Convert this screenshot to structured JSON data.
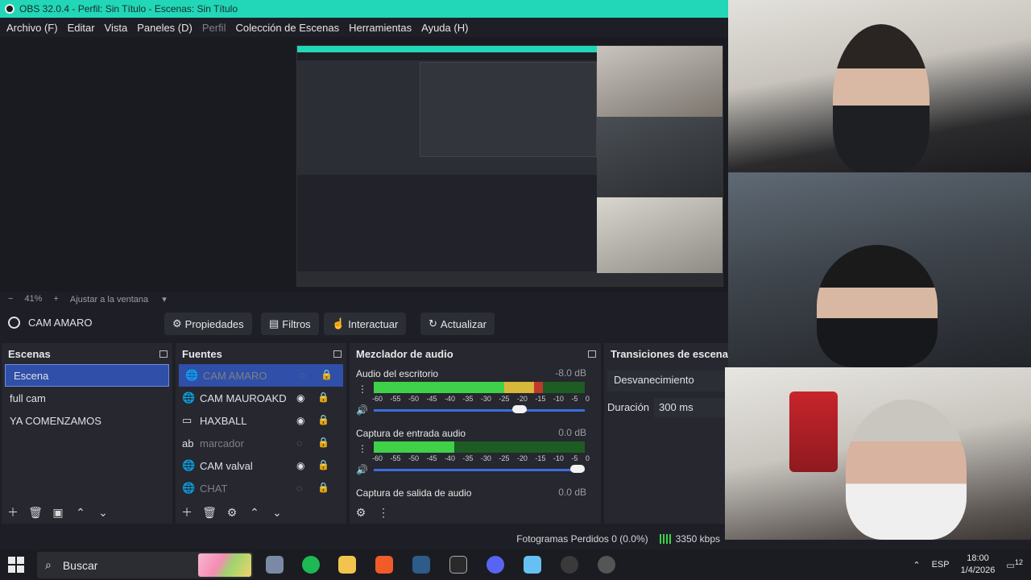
{
  "window": {
    "title": "OBS 32.0.4 - Perfil: Sin Título - Escenas: Sin Título"
  },
  "menu": [
    {
      "label": "Archivo (F)",
      "enabled": true
    },
    {
      "label": "Editar",
      "enabled": true
    },
    {
      "label": "Vista",
      "enabled": true
    },
    {
      "label": "Paneles (D)",
      "enabled": true
    },
    {
      "label": "Perfil",
      "enabled": false
    },
    {
      "label": "Colección de Escenas",
      "enabled": true
    },
    {
      "label": "Herramientas",
      "enabled": true
    },
    {
      "label": "Ayuda (H)",
      "enabled": true
    }
  ],
  "zoom": {
    "minus": "−",
    "value": "41%",
    "plus": "+",
    "fit_label": "Ajustar a la ventana"
  },
  "source_toolbar": {
    "selected_source": "CAM AMARO",
    "properties": "Propiedades",
    "filters": "Filtros",
    "interact": "Interactuar",
    "refresh": "Actualizar"
  },
  "scenes": {
    "title": "Escenas",
    "items": [
      "Escena",
      "full cam",
      "YA COMENZAMOS"
    ],
    "selected_index": 0
  },
  "sources": {
    "title": "Fuentes",
    "items": [
      {
        "name": "CAM AMARO",
        "type": "browser-icon",
        "visible": false,
        "selected": true
      },
      {
        "name": "CAM MAUROAKD",
        "type": "browser-icon",
        "visible": true,
        "selected": false
      },
      {
        "name": "HAXBALL",
        "type": "window-capture-icon",
        "visible": true,
        "selected": false
      },
      {
        "name": "marcador",
        "type": "text-icon",
        "visible": false,
        "selected": false
      },
      {
        "name": "CAM valval",
        "type": "browser-icon",
        "visible": true,
        "selected": false
      },
      {
        "name": "CHAT",
        "type": "browser-icon",
        "visible": false,
        "selected": false
      }
    ]
  },
  "mixer": {
    "title": "Mezclador de audio",
    "channels": [
      {
        "name": "Audio del escritorio",
        "db": "-8.0 dB",
        "level": 0.86,
        "volume": 0.68
      },
      {
        "name": "Captura de entrada audio",
        "db": "0.0 dB",
        "level": 0.36,
        "volume": 1.0
      },
      {
        "name": "Captura de salida de audio",
        "db": "0.0 dB"
      }
    ],
    "ticks": [
      "-60",
      "-55",
      "-50",
      "-45",
      "-40",
      "-35",
      "-30",
      "-25",
      "-20",
      "-15",
      "-10",
      "-5",
      "0"
    ]
  },
  "transitions": {
    "title": "Transiciones de escena",
    "current": "Desvanecimiento",
    "duration_label": "Duración",
    "duration_value": "300 ms"
  },
  "status": {
    "dropped_frames": "Fotogramas Perdidos 0 (0.0%)",
    "bitrate": "3350 kbps"
  },
  "taskbar": {
    "search_placeholder": "Buscar",
    "language": "ESP",
    "time": "18:00",
    "date": "1/4/2026",
    "notifications": "12"
  },
  "colors": {
    "title_accent": "#21d7b8",
    "selection": "#2f4fa8",
    "meter_green": "#3fd14a",
    "meter_yellow": "#d8b83b",
    "meter_red": "#c0392b"
  }
}
